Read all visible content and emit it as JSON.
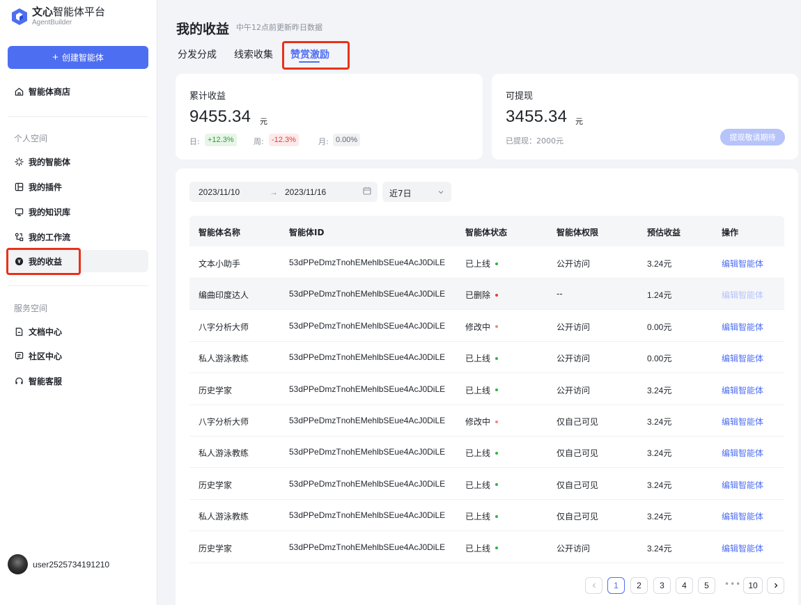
{
  "sidebar": {
    "logo": {
      "title_bold": "文心",
      "title_rest": "智能体平台",
      "subtitle": "AgentBuilder"
    },
    "create_label": "创建智能体",
    "store_label": "智能体商店",
    "personal_section": "个人空间",
    "personal_items": [
      {
        "label": "我的智能体",
        "icon": "sparkle-icon"
      },
      {
        "label": "我的插件",
        "icon": "plugin-icon"
      },
      {
        "label": "我的知识库",
        "icon": "monitor-icon"
      },
      {
        "label": "我的工作流",
        "icon": "workflow-icon"
      },
      {
        "label": "我的收益",
        "icon": "yen-coin-icon"
      }
    ],
    "service_section": "服务空间",
    "service_items": [
      {
        "label": "文档中心",
        "icon": "document-icon"
      },
      {
        "label": "社区中心",
        "icon": "chat-icon"
      },
      {
        "label": "智能客服",
        "icon": "headset-icon"
      }
    ],
    "username": "user2525734191210"
  },
  "header": {
    "title": "我的收益",
    "subtitle": "中午12点前更新昨日数据",
    "tabs": [
      "分发分成",
      "线索收集",
      "赞赏激励"
    ],
    "active_tab": "赞赏激励"
  },
  "summary": {
    "total": {
      "label": "累计收益",
      "value": "9455.34",
      "unit": "元",
      "day_label": "日:",
      "day_change": "+12.3%",
      "week_label": "周:",
      "week_change": "-12.3%",
      "month_label": "月:",
      "month_change": "0.00%"
    },
    "withdrawable": {
      "label": "可提现",
      "value": "3455.34",
      "unit": "元",
      "withdrawn": "已提现：2000元",
      "button": "提现敬请期待"
    }
  },
  "filters": {
    "start_date": "2023/11/10",
    "arrow": "→",
    "end_date": "2023/11/16",
    "period": "近7日"
  },
  "table": {
    "columns": [
      "智能体名称",
      "智能体ID",
      "智能体状态",
      "智能体权限",
      "预估收益",
      "操作"
    ],
    "rows": [
      {
        "name": "文本小助手",
        "id": "53dPPeDmzTnohEMehlbSEue4AcJ0DiLE",
        "status": "已上线",
        "status_color": "#2fb344",
        "permission": "公开访问",
        "revenue": "3.24元",
        "action": "编辑智能体",
        "disabled": false
      },
      {
        "name": "编曲印度达人",
        "id": "53dPPeDmzTnohEMehlbSEue4AcJ0DiLE",
        "status": "已删除",
        "status_color": "#e53b3b",
        "permission": "--",
        "revenue": "1.24元",
        "action": "编辑智能体",
        "disabled": true
      },
      {
        "name": "八字分析大师",
        "id": "53dPPeDmzTnohEMehlbSEue4AcJ0DiLE",
        "status": "修改中",
        "status_color": "#f08a7a",
        "permission": "公开访问",
        "revenue": "0.00元",
        "action": "编辑智能体",
        "disabled": false
      },
      {
        "name": "私人游泳教练",
        "id": "53dPPeDmzTnohEMehlbSEue4AcJ0DiLE",
        "status": "已上线",
        "status_color": "#2fb344",
        "permission": "公开访问",
        "revenue": "0.00元",
        "action": "编辑智能体",
        "disabled": false
      },
      {
        "name": "历史学家",
        "id": "53dPPeDmzTnohEMehlbSEue4AcJ0DiLE",
        "status": "已上线",
        "status_color": "#2fb344",
        "permission": "公开访问",
        "revenue": "3.24元",
        "action": "编辑智能体",
        "disabled": false
      },
      {
        "name": "八字分析大师",
        "id": "53dPPeDmzTnohEMehlbSEue4AcJ0DiLE",
        "status": "修改中",
        "status_color": "#f08a7a",
        "permission": "仅自己可见",
        "revenue": "3.24元",
        "action": "编辑智能体",
        "disabled": false
      },
      {
        "name": "私人游泳教练",
        "id": "53dPPeDmzTnohEMehlbSEue4AcJ0DiLE",
        "status": "已上线",
        "status_color": "#2fb344",
        "permission": "仅自己可见",
        "revenue": "3.24元",
        "action": "编辑智能体",
        "disabled": false
      },
      {
        "name": "历史学家",
        "id": "53dPPeDmzTnohEMehlbSEue4AcJ0DiLE",
        "status": "已上线",
        "status_color": "#2fb344",
        "permission": "仅自己可见",
        "revenue": "3.24元",
        "action": "编辑智能体",
        "disabled": false
      },
      {
        "name": "私人游泳教练",
        "id": "53dPPeDmzTnohEMehlbSEue4AcJ0DiLE",
        "status": "已上线",
        "status_color": "#2fb344",
        "permission": "仅自己可见",
        "revenue": "3.24元",
        "action": "编辑智能体",
        "disabled": false
      },
      {
        "name": "历史学家",
        "id": "53dPPeDmzTnohEMehlbSEue4AcJ0DiLE",
        "status": "已上线",
        "status_color": "#2fb344",
        "permission": "公开访问",
        "revenue": "3.24元",
        "action": "编辑智能体",
        "disabled": false
      }
    ]
  },
  "pagination": {
    "pages": [
      "1",
      "2",
      "3",
      "4",
      "5"
    ],
    "ellipsis": "•••",
    "last": "10",
    "current": "1"
  },
  "colors": {
    "accent": "#4e6ef2",
    "highlight": "#e8311a"
  }
}
